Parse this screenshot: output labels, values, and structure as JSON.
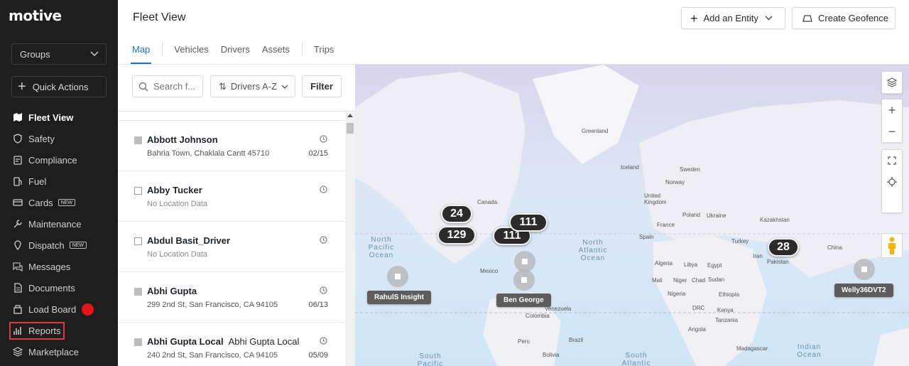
{
  "sidebar": {
    "logo": "motive",
    "groups_label": "Groups",
    "quick_actions_label": "Quick Actions",
    "items": [
      {
        "label": "Fleet View",
        "icon": "map-icon",
        "active": true
      },
      {
        "label": "Safety",
        "icon": "shield-icon"
      },
      {
        "label": "Compliance",
        "icon": "clipboard-icon"
      },
      {
        "label": "Fuel",
        "icon": "fuel-icon"
      },
      {
        "label": "Cards",
        "icon": "card-icon",
        "badge": "NEW"
      },
      {
        "label": "Maintenance",
        "icon": "wrench-icon"
      },
      {
        "label": "Dispatch",
        "icon": "dispatch-icon",
        "badge": "NEW"
      },
      {
        "label": "Messages",
        "icon": "messages-icon"
      },
      {
        "label": "Documents",
        "icon": "document-icon"
      },
      {
        "label": "Load Board",
        "icon": "load-board-icon"
      },
      {
        "label": "Reports",
        "icon": "reports-icon",
        "highlighted": true
      },
      {
        "label": "Marketplace",
        "icon": "marketplace-icon"
      }
    ]
  },
  "header": {
    "title": "Fleet View",
    "add_entity_label": "Add an Entity",
    "create_geofence_label": "Create Geofence"
  },
  "tabs": [
    "Map",
    "Vehicles",
    "Drivers",
    "Assets",
    "Trips"
  ],
  "toolbar": {
    "search_placeholder": "Search f...",
    "sort_label": "Drivers A-Z",
    "filter_label": "Filter"
  },
  "drivers": [
    {
      "name": "Abbott Johnson",
      "extra": "",
      "address": "Bahria Town, Chaklala Cantt 45710",
      "date": "02/15",
      "checkbox": "filled"
    },
    {
      "name": "Abby Tucker",
      "extra": "",
      "address": "No Location Data",
      "date": "",
      "checkbox": "empty"
    },
    {
      "name": "Abdul Basit_Driver",
      "extra": "",
      "address": "No Location Data",
      "date": "",
      "checkbox": "empty"
    },
    {
      "name": "Abhi Gupta",
      "extra": "",
      "address": "299 2nd St, San Francisco, CA 94105",
      "date": "06/13",
      "checkbox": "filled"
    },
    {
      "name": "Abhi Gupta Local",
      "extra": "Abhi Gupta Local",
      "address": "240 2nd St, San Francisco, CA 94105",
      "date": "05/09",
      "checkbox": "filled"
    }
  ],
  "map": {
    "clusters": [
      "24",
      "129",
      "111",
      "111",
      "28"
    ],
    "vehicle_tags": [
      "RahulS Insight",
      "Ben George",
      "Welly36DVT2"
    ],
    "place_labels": [
      "Greenland",
      "Canada",
      "Iceland",
      "Sweden",
      "Norway",
      "United Kingdom",
      "Ukraine",
      "Poland",
      "France",
      "Spain",
      "Kazakhstan",
      "Turkey",
      "Iran",
      "Pakistan",
      "China",
      "Algeria",
      "Libya",
      "Egypt",
      "Mali",
      "Niger",
      "Chad",
      "Sudan",
      "Nigeria",
      "Ethiopia",
      "DRC",
      "Kenya",
      "Tanzania",
      "Angola",
      "Madagascar",
      "Mexico",
      "Venezuela",
      "Colombia",
      "Peru",
      "Brazil",
      "Bolivia"
    ],
    "oceans": [
      "North Pacific Ocean",
      "North Atlantic Ocean",
      "Indian Ocean",
      "South Pacific",
      "South Atlantic"
    ]
  }
}
